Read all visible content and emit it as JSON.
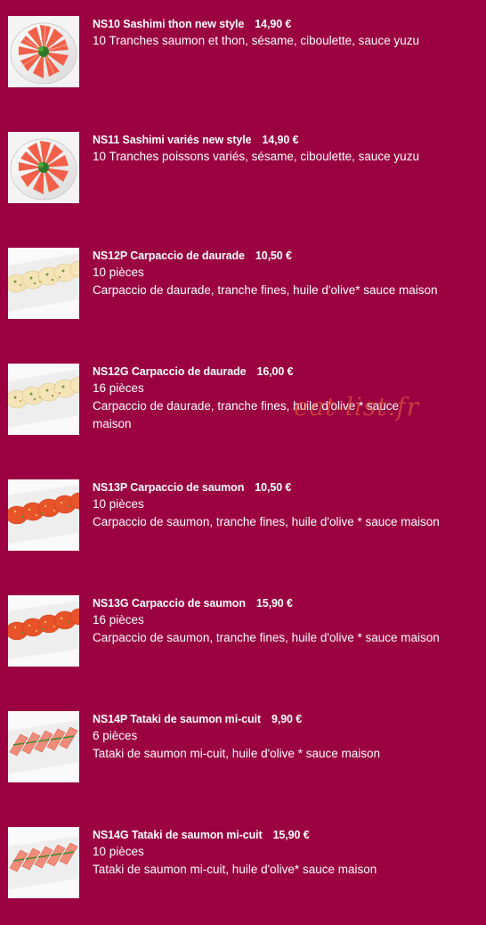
{
  "watermark": "eat-list.fr",
  "items": [
    {
      "title": "NS10 Sashimi thon new style",
      "price": "14,90 €",
      "lines": [
        "10 Tranches saumon et thon, sésame, ciboulette, sauce yuzu"
      ],
      "photo_icon": "sashimi-plate-icon"
    },
    {
      "title": "NS11 Sashimi variés new style",
      "price": "14,90 €",
      "lines": [
        "10 Tranches poissons variés, sésame, ciboulette, sauce yuzu"
      ],
      "photo_icon": "sashimi-plate-icon"
    },
    {
      "title": "NS12P Carpaccio de daurade",
      "price": "10,50 €",
      "lines": [
        "10 pièces",
        "Carpaccio de daurade, tranche fines, huile d'olive* sauce maison"
      ],
      "photo_icon": "daurade-carpaccio-icon"
    },
    {
      "title": "NS12G Carpaccio de daurade",
      "price": "16,00 €",
      "lines": [
        "16 pièces",
        "Carpaccio de daurade, tranche fines, huile d'olive * sauce",
        "maison"
      ],
      "photo_icon": "daurade-carpaccio-icon"
    },
    {
      "title": "NS13P Carpaccio de saumon",
      "price": "10,50 €",
      "lines": [
        "10 pièces",
        "Carpaccio de saumon, tranche fines, huile d'olive * sauce maison"
      ],
      "photo_icon": "saumon-carpaccio-icon"
    },
    {
      "title": "NS13G Carpaccio de saumon",
      "price": "15,90 €",
      "lines": [
        "16 pièces",
        "Carpaccio de saumon, tranche fines, huile d'olive * sauce maison"
      ],
      "photo_icon": "saumon-carpaccio-icon"
    },
    {
      "title": "NS14P Tataki de saumon mi-cuit",
      "price": "9,90 €",
      "lines": [
        "6 pièces",
        "Tataki de saumon mi-cuit, huile d'olive * sauce maison"
      ],
      "photo_icon": "tataki-icon"
    },
    {
      "title": "NS14G Tataki de saumon mi-cuit",
      "price": "15,90 €",
      "lines": [
        "10 pièces",
        "Tataki de saumon mi-cuit, huile d'olive* sauce maison"
      ],
      "photo_icon": "tataki-icon"
    }
  ]
}
